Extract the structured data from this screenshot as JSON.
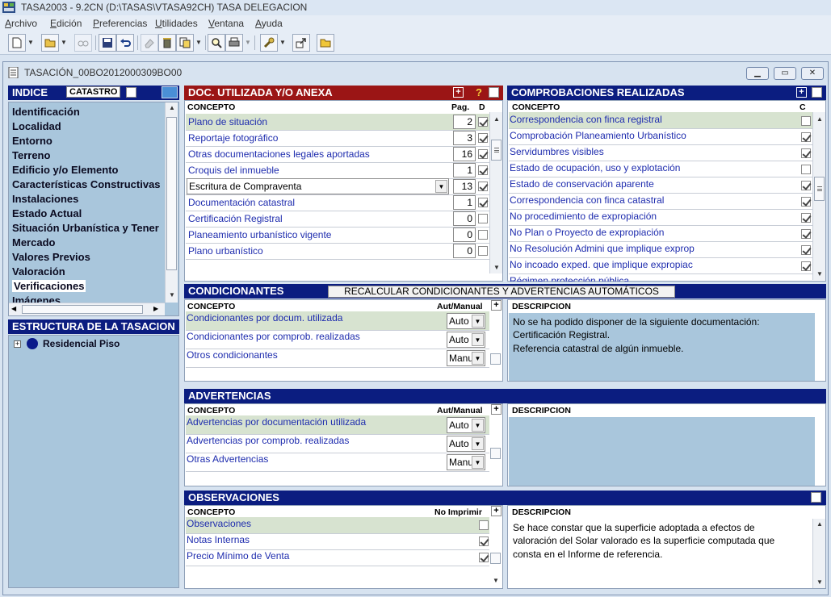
{
  "app": {
    "title": "TASA2003 - 9.2CN (D:\\TASAS\\VTASA92CH)    TASA DELEGACION",
    "menu": [
      "Archivo",
      "Edición",
      "Preferencias",
      "Utilidades",
      "Ventana",
      "Ayuda"
    ]
  },
  "window": {
    "title": "TASACIÓN_00BO2012000309BO00"
  },
  "indice": {
    "header": "INDICE",
    "catastro_label": "CATASTRO",
    "items": [
      "Identificación",
      "Localidad",
      "Entorno",
      "Terreno",
      "Edificio y/o Elemento",
      "Características Constructivas",
      "Instalaciones",
      "Estado Actual",
      "Situación Urbanística y Tener",
      "Mercado",
      "Valores Previos",
      "Valoración",
      "Verificaciones",
      "Imágenes"
    ],
    "selected": "Verificaciones"
  },
  "estructura": {
    "header": "ESTRUCTURA DE LA TASACION",
    "node": "Residencial Piso",
    "expander": "+"
  },
  "doc": {
    "header": "DOC. UTILIZADA Y/O ANEXA",
    "col_concepto": "CONCEPTO",
    "col_pag": "Pag.",
    "col_d": "D",
    "plus": "+",
    "help": "?",
    "rows": [
      {
        "label": "Plano de situación",
        "pag": "2",
        "checked": true
      },
      {
        "label": "Reportaje fotográfico",
        "pag": "3",
        "checked": true
      },
      {
        "label": "Otras documentaciones legales aportadas",
        "pag": "16",
        "checked": true
      },
      {
        "label": "Croquis del inmueble",
        "pag": "1",
        "checked": true
      },
      {
        "label": "Escritura de Compraventa",
        "pag": "13",
        "checked": true
      },
      {
        "label": "Documentación catastral",
        "pag": "1",
        "checked": true
      },
      {
        "label": "Certificación Registral",
        "pag": "0",
        "checked": false
      },
      {
        "label": "Planeamiento urbanístico vigente",
        "pag": "0",
        "checked": false
      },
      {
        "label": "Plano urbanístico",
        "pag": "0",
        "checked": false
      }
    ]
  },
  "comprob": {
    "header": "COMPROBACIONES REALIZADAS",
    "col_concepto": "CONCEPTO",
    "col_c": "C",
    "plus": "+",
    "rows": [
      {
        "label": "Correspondencia con finca registral",
        "checked": false
      },
      {
        "label": "Comprobación Planeamiento Urbanístico",
        "checked": true
      },
      {
        "label": "Servidumbres visibles",
        "checked": true
      },
      {
        "label": "Estado de ocupación, uso y explotación",
        "checked": false
      },
      {
        "label": "Estado de conservación aparente",
        "checked": true
      },
      {
        "label": "Correspondencia con finca catastral",
        "checked": true
      },
      {
        "label": "No procedimiento de expropiación",
        "checked": true
      },
      {
        "label": "No Plan o Proyecto de expropiación",
        "checked": true
      },
      {
        "label": "No Resolución Admini que implique exprop",
        "checked": true
      },
      {
        "label": "No incoado exped. que implique expropiac",
        "checked": true
      },
      {
        "label": "Régimen protección pública",
        "checked": false
      }
    ]
  },
  "condicionantes": {
    "header": "CONDICIONANTES",
    "recalc_button": "RECALCULAR CONDICIONANTES Y ADVERTENCIAS AUTOMÁTICOS",
    "col_concepto": "CONCEPTO",
    "col_aut": "Aut/Manual",
    "col_desc": "DESCRIPCION",
    "plus": "+",
    "rows": [
      {
        "label": "Condicionantes por docum. utilizada",
        "mode": "Auto"
      },
      {
        "label": "Condicionantes por comprob. realizadas",
        "mode": "Auto"
      },
      {
        "label": "Otros condicionantes",
        "mode": "Manu"
      }
    ],
    "description": [
      "No se ha podido disponer de la siguiente documentación:",
      "Certificación Registral.",
      "Referencia catastral de algún inmueble."
    ]
  },
  "advertencias": {
    "header": "ADVERTENCIAS",
    "col_concepto": "CONCEPTO",
    "col_aut": "Aut/Manual",
    "col_desc": "DESCRIPCION",
    "plus": "+",
    "rows": [
      {
        "label": "Advertencias por documentación utilizada",
        "mode": "Auto"
      },
      {
        "label": "Advertencias por comprob. realizadas",
        "mode": "Auto"
      },
      {
        "label": "Otras Advertencias",
        "mode": "Manu"
      }
    ]
  },
  "observaciones": {
    "header": "OBSERVACIONES",
    "col_concepto": "CONCEPTO",
    "col_noimp": "No Imprimir",
    "col_desc": "DESCRIPCION",
    "plus": "+",
    "rows": [
      {
        "label": "Observaciones",
        "checked": false
      },
      {
        "label": "Notas Internas",
        "checked": true
      },
      {
        "label": "Precio Mínimo de Venta",
        "checked": true
      }
    ],
    "description": [
      "Se hace constar que la superficie adoptada a efectos de",
      "valoración del Solar valorado es la superficie computada que",
      "consta en el Informe de referencia."
    ]
  },
  "colors": {
    "header_blue": "#0b1d80",
    "header_red": "#9b1515",
    "link": "#1e2cae",
    "panel_blue": "#a9c6dc"
  }
}
